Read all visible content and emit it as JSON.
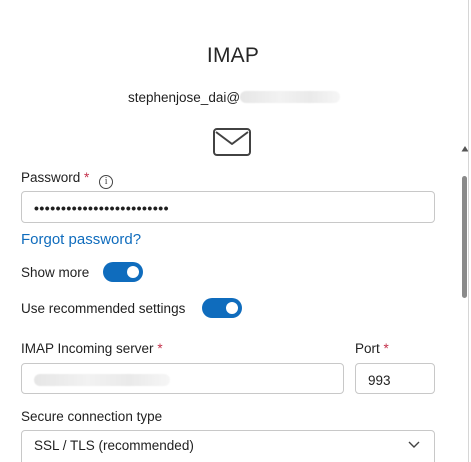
{
  "dialog": {
    "title": "IMAP",
    "email_prefix": "stephenjose_dai@"
  },
  "password": {
    "label": "Password",
    "required_mark": "*",
    "info_glyph": "i",
    "masked_value": "•••••••••••••••••••••••••"
  },
  "forgot_password": "Forgot password?",
  "show_more": {
    "label": "Show more",
    "on": true
  },
  "use_recommended": {
    "label": "Use recommended settings",
    "on": true
  },
  "incoming_server": {
    "label": "IMAP Incoming server",
    "required_mark": "*"
  },
  "port": {
    "label": "Port",
    "required_mark": "*",
    "value": "993"
  },
  "secure_connection": {
    "label": "Secure connection type",
    "selected": "SSL / TLS (recommended)"
  },
  "icons": {
    "mail": "mail-envelope-icon",
    "info": "info-icon",
    "chevron": "chevron-down-icon",
    "scroll_up": "scroll-up-arrow-icon"
  },
  "colors": {
    "accent": "#0f6cbd",
    "required": "#c4314b",
    "border": "#c8c8c8"
  }
}
